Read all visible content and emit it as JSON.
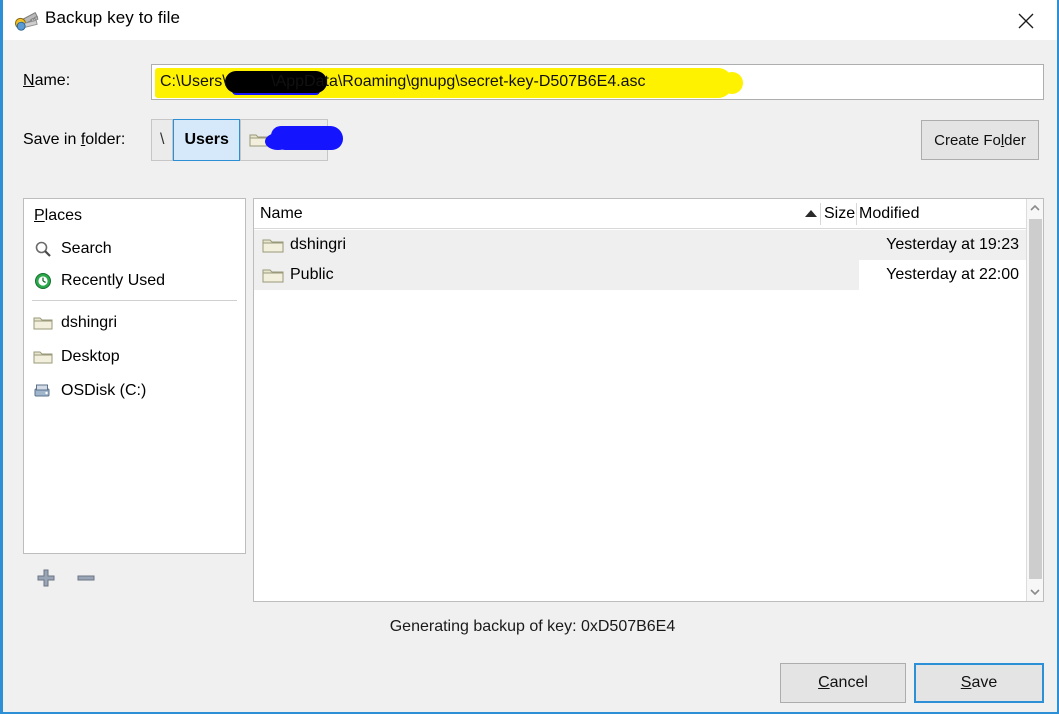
{
  "window": {
    "title": "Backup key to file",
    "icon": "key-icon",
    "close_icon": "close-icon",
    "accent_color": "#2d8fd5",
    "background_color": "#f0f0f0"
  },
  "name_row": {
    "label": "Name:",
    "label_mnemonic": "N",
    "value": "C:\\Users\\          \\AppData\\Roaming\\gnupg\\secret-key-D507B6E4.asc",
    "placeholder": "",
    "annotations": {
      "highlight_color": "#fff200",
      "redaction_color": "#000000",
      "redaction_underline_color": "#1414ff"
    }
  },
  "folder_row": {
    "label": "Save in folder:",
    "label_mnemonic": "f",
    "crumbs": [
      {
        "label": "\\",
        "type": "separator",
        "selected": false
      },
      {
        "label": "Users",
        "type": "folder",
        "selected": true
      },
      {
        "label": "",
        "type": "folder-redacted",
        "selected": false
      }
    ],
    "redaction_color": "#1414ff",
    "create_folder_label": "Create Folder",
    "create_folder_mnemonic": "l"
  },
  "places": {
    "header": "Places",
    "header_mnemonic": "P",
    "items": [
      {
        "label": "Search",
        "icon": "search-icon"
      },
      {
        "label": "Recently Used",
        "icon": "recent-clock-icon"
      },
      {
        "label": "dshingri",
        "icon": "folder-icon"
      },
      {
        "label": "Desktop",
        "icon": "folder-icon"
      },
      {
        "label": "OSDisk (C:)",
        "icon": "drive-icon"
      }
    ],
    "toolbar": [
      {
        "name": "add-place-button",
        "icon": "plus-icon"
      },
      {
        "name": "remove-place-button",
        "icon": "minus-icon"
      }
    ]
  },
  "file_list": {
    "columns": [
      {
        "label": "Name",
        "sorted": "ascending"
      },
      {
        "label": "Size",
        "sorted": "none"
      },
      {
        "label": "Modified",
        "sorted": "none"
      }
    ],
    "sort_indicator": "▲",
    "rows": [
      {
        "name": "dshingri",
        "icon": "folder-icon",
        "size": "",
        "modified": "Yesterday at 19:23"
      },
      {
        "name": "Public",
        "icon": "folder-icon",
        "size": "",
        "modified": "Yesterday at 22:00"
      }
    ],
    "scrollbar": {
      "up_icon": "chevron-up-icon",
      "down_icon": "chevron-down-icon"
    }
  },
  "status": {
    "text": "Generating backup of key: 0xD507B6E4"
  },
  "footer": {
    "cancel_label": "Cancel",
    "cancel_mnemonic": "C",
    "save_label": "Save",
    "save_mnemonic": "S",
    "save_focused": true
  }
}
